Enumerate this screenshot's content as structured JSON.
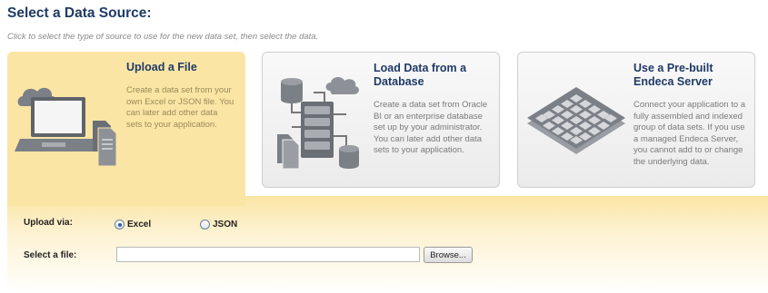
{
  "header": {
    "title": "Select a Data Source:",
    "subtitle": "Click to select the type of source to use for the new data set, then select the data."
  },
  "sources": [
    {
      "title": "Upload a File",
      "description": "Create a data set from your own Excel or JSON file. You can later add other data sets to your application.",
      "icon": "laptop-upload-icon",
      "selected": true
    },
    {
      "title": "Load Data from a Database",
      "description": "Create a data set from Oracle BI or an enterprise database set up by your administrator. You can later add other data sets to your application.",
      "icon": "database-server-icon",
      "selected": false
    },
    {
      "title": "Use a Pre-built Endeca Server",
      "description": "Connect your application to a fully assembled and indexed group of data sets. If you use a managed Endeca Server, you cannot add to or change the underlying data.",
      "icon": "data-grid-icon",
      "selected": false
    }
  ],
  "upload": {
    "via_label": "Upload via:",
    "options": [
      {
        "label": "Excel",
        "selected": true
      },
      {
        "label": "JSON",
        "selected": false
      }
    ],
    "file_label": "Select a file:",
    "file_value": "",
    "browse_label": "Browse..."
  },
  "colors": {
    "title": "#1f3a66",
    "selected_background": "#fbe5a4",
    "card_background": "#eeeeee"
  }
}
